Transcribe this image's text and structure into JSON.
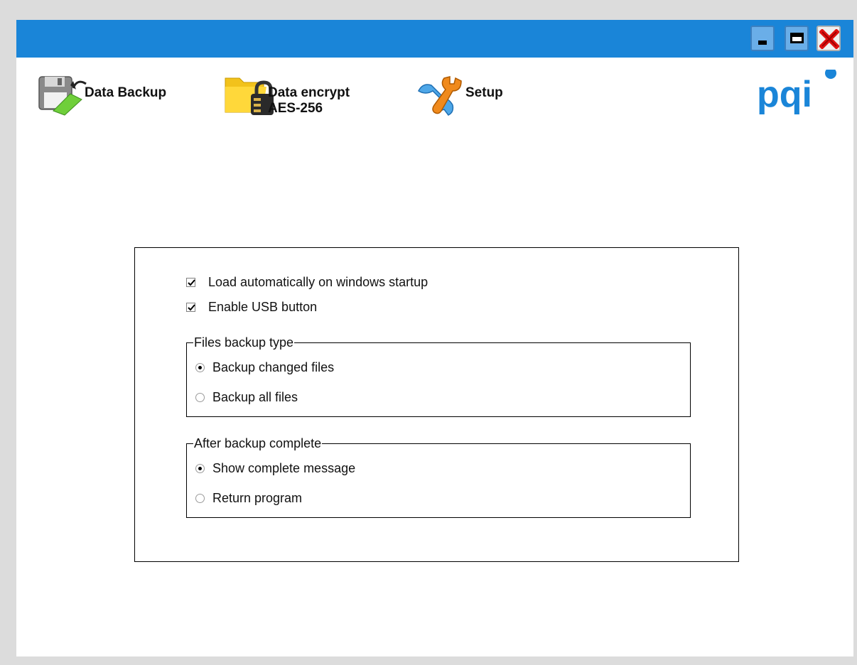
{
  "window": {
    "controls": {
      "minimize_icon": "minimize-icon",
      "maximize_icon": "maximize-icon",
      "close_icon": "close-icon"
    },
    "titlebar_color": "#1a85d8"
  },
  "nav": {
    "items": [
      {
        "label": "Data Backup",
        "icon": "floppy-backup-icon"
      },
      {
        "label": "Data encrypt\nAES-256",
        "icon": "folder-lock-icon"
      },
      {
        "label": "Setup",
        "icon": "tools-icon"
      }
    ]
  },
  "logo": {
    "text": "pqi",
    "color": "#1a85d8"
  },
  "settings": {
    "load_on_startup": {
      "label": "Load automatically on windows startup",
      "checked": true
    },
    "enable_usb_button": {
      "label": "Enable USB button",
      "checked": true
    },
    "backup_type": {
      "legend": "Files backup type",
      "options": [
        {
          "label": "Backup changed files",
          "selected": true
        },
        {
          "label": "Backup all files",
          "selected": false
        }
      ]
    },
    "after_backup": {
      "legend": "After backup complete",
      "options": [
        {
          "label": "Show complete message",
          "selected": true
        },
        {
          "label": "Return program",
          "selected": false
        }
      ]
    }
  }
}
